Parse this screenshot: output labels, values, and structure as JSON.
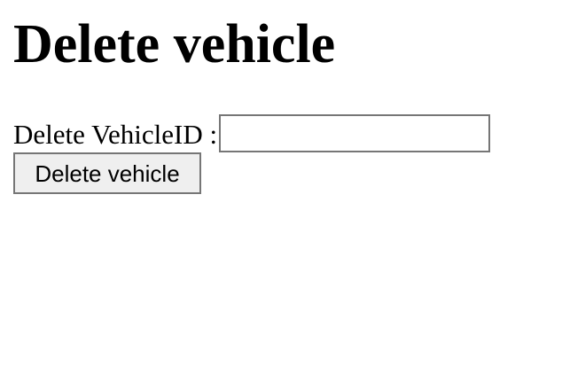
{
  "page": {
    "title": "Delete vehicle"
  },
  "form": {
    "vehicle_id_label": "Delete VehicleID :",
    "vehicle_id_value": "",
    "submit_label": "Delete vehicle"
  }
}
